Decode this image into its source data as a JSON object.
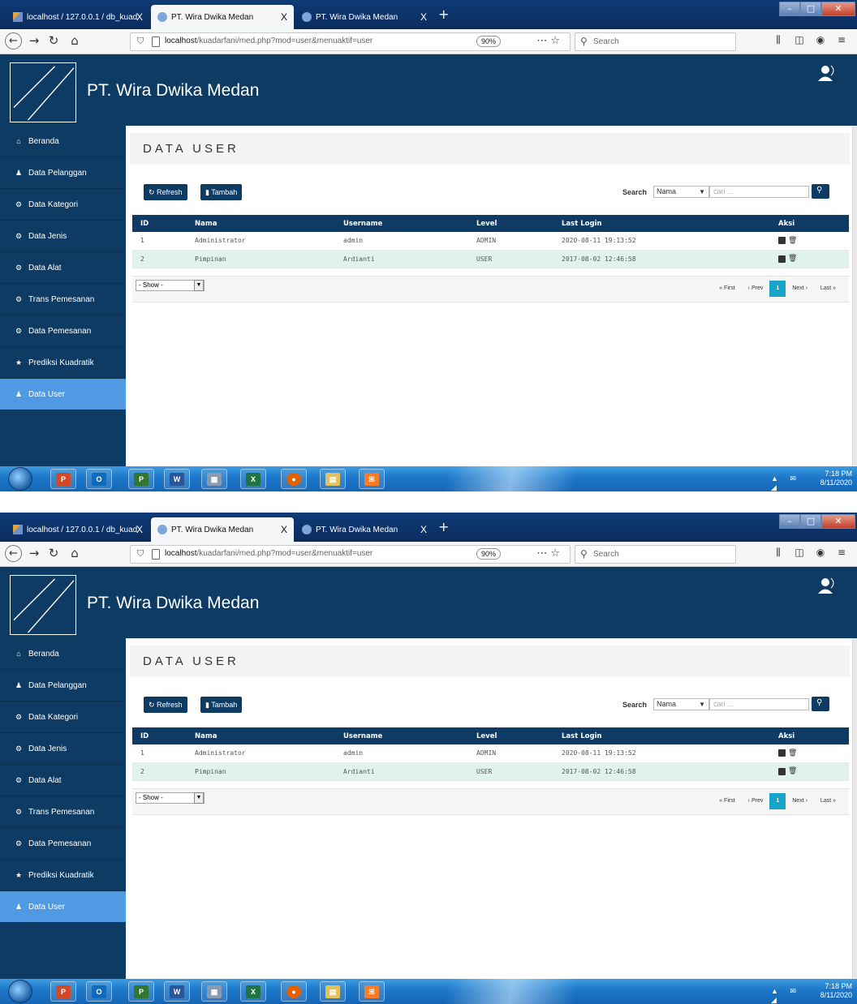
{
  "browser": {
    "tabs": [
      {
        "title": "localhost / 127.0.0.1 / db_kuad",
        "close": "X"
      },
      {
        "title": "PT. Wira Dwika Medan",
        "close": "X"
      },
      {
        "title": "PT. Wira Dwika Medan",
        "close": "X"
      }
    ],
    "new_tab": "+",
    "url_host": "localhost",
    "url_path": "/kuadarfani/med.php?mod=user&menuaktif=user",
    "zoom": "90%",
    "search_placeholder": "Search"
  },
  "header": {
    "site_title": "PT. Wira Dwika Medan"
  },
  "sidebar": {
    "items": [
      {
        "label": "Beranda",
        "icon": "home-icon"
      },
      {
        "label": "Data Pelanggan",
        "icon": "user-icon"
      },
      {
        "label": "Data Kategori",
        "icon": "cogs-icon"
      },
      {
        "label": "Data Jenis",
        "icon": "cogs-icon"
      },
      {
        "label": "Data Alat",
        "icon": "cogs-icon"
      },
      {
        "label": "Trans Pemesanan",
        "icon": "cogs-icon"
      },
      {
        "label": "Data Pemesanan",
        "icon": "cogs-icon"
      },
      {
        "label": "Prediksi Kuadratik",
        "icon": "star-icon"
      },
      {
        "label": "Data User",
        "icon": "user-icon",
        "active": true
      }
    ]
  },
  "main": {
    "page_title": "DATA USER",
    "refresh_label": "Refresh",
    "tambah_label": "Tambah",
    "search_label": "Search",
    "search_field": "Nama",
    "search_placeholder": "cari ...",
    "table": {
      "headers": [
        "ID",
        "Nama",
        "Username",
        "Level",
        "Last Login",
        "Aksi"
      ],
      "rows": [
        [
          "1",
          "Administrator",
          "admin",
          "ADMIN",
          "2020-08-11 19:13:52"
        ],
        [
          "2",
          "Pimpinan",
          "Ardianti",
          "USER",
          "2017-08-02 12:46:58"
        ]
      ]
    },
    "show_select": "- Show -",
    "pager": {
      "first": "« First",
      "prev": "‹ Prev",
      "current": "1",
      "next": "Next ›",
      "last": "Last »"
    }
  },
  "taskbar": {
    "apps": [
      {
        "name": "powerpoint",
        "glyph": "P",
        "color": "#d24726"
      },
      {
        "name": "outlook",
        "glyph": "O",
        "color": "#0f6cbd"
      },
      {
        "name": "project",
        "glyph": "P",
        "color": "#31752f"
      },
      {
        "name": "word",
        "glyph": "W",
        "color": "#2b579a"
      },
      {
        "name": "calculator",
        "glyph": "▦",
        "color": "#8a9bb0"
      },
      {
        "name": "excel",
        "glyph": "X",
        "color": "#217346"
      },
      {
        "name": "firefox",
        "glyph": "●",
        "color": "#e66000"
      },
      {
        "name": "explorer",
        "glyph": "▤",
        "color": "#e3c25a"
      },
      {
        "name": "xampp",
        "glyph": "ꕤ",
        "color": "#fb7a24"
      }
    ],
    "time": "7:18 PM",
    "date": "8/11/2020",
    "tray": "▲ ✉ ◢"
  }
}
